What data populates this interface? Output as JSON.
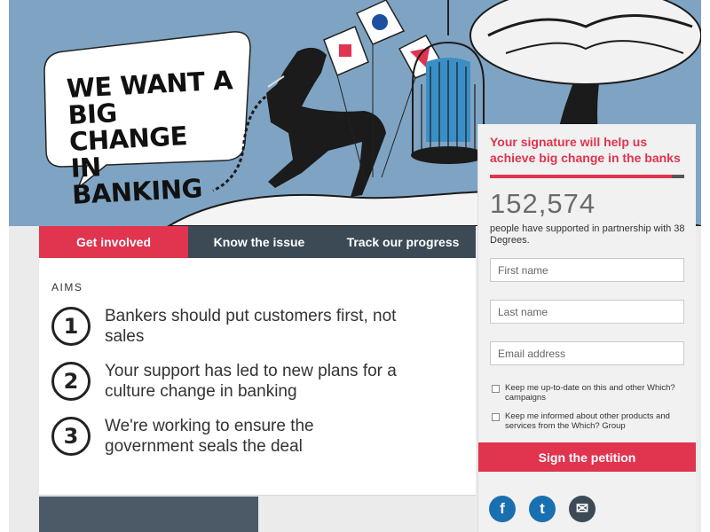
{
  "hero": {
    "headline_lines": [
      "WE WANT A",
      "BIG CHANGE",
      "IN BANKING"
    ]
  },
  "tabs": [
    {
      "label": "Get involved",
      "active": true
    },
    {
      "label": "Know the issue",
      "active": false
    },
    {
      "label": "Track our progress",
      "active": false
    }
  ],
  "aims": {
    "label": "AIMS",
    "items": [
      {
        "number": "1",
        "text": "Bankers should put customers first, not sales"
      },
      {
        "number": "2",
        "text": "Your support has led to new plans for a culture change in banking"
      },
      {
        "number": "3",
        "text": "We're working to ensure the government seals the deal"
      }
    ]
  },
  "petition": {
    "heading": "Your signature will help us achieve big change in the banks",
    "count": "152,574",
    "subtext": "people have supported in partnership with 38 Degrees.",
    "fields": {
      "first_name_placeholder": "First name",
      "last_name_placeholder": "Last name",
      "email_placeholder": "Email address"
    },
    "checkboxes": [
      {
        "label": "Keep me up-to-date on this and other Which? campaigns",
        "checked": false
      },
      {
        "label": "Keep me informed about other products and services from the Which? Group",
        "checked": false
      }
    ],
    "sign_label": "Sign the petition"
  },
  "social": {
    "facebook_glyph": "f",
    "twitter_glyph": "t",
    "email_glyph": "✉"
  },
  "colors": {
    "accent": "#e0344f",
    "hero_sky": "#7fa4c3",
    "tab_dark": "#3c4a56",
    "social_blue": "#1a6fb0"
  }
}
